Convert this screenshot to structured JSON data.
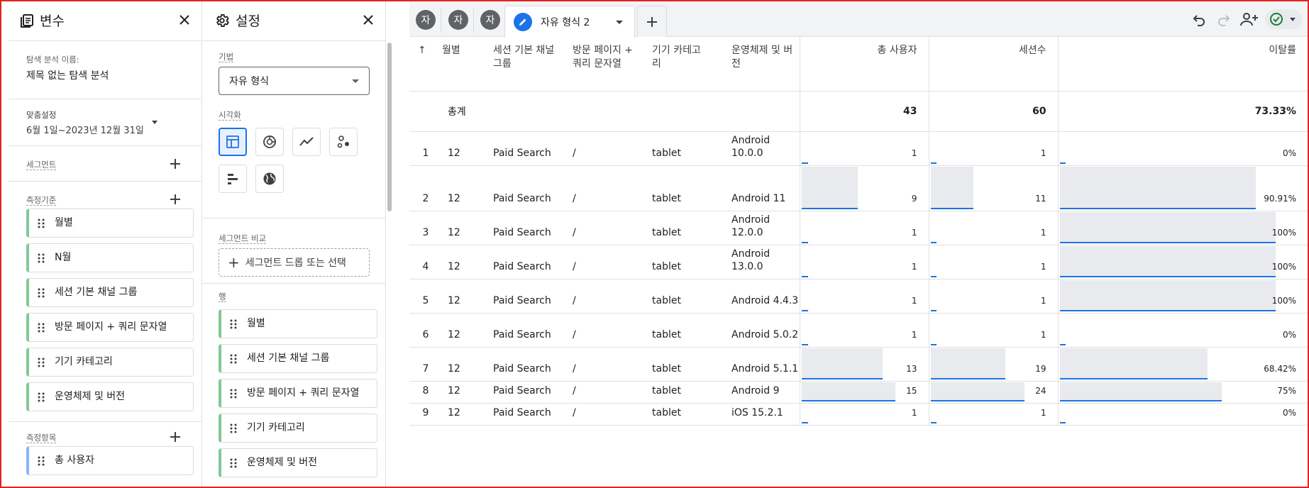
{
  "variables_panel": {
    "title": "변수",
    "exploration_name_label": "탐색 분석 이름:",
    "exploration_name": "제목 없는 탐색 분석",
    "date_label": "맞춤설정",
    "date_range": "6월 1일~2023년 12월 31일",
    "segments_label": "세그먼트",
    "dimensions_label": "측정기준",
    "dimensions": [
      "월별",
      "N월",
      "세션 기본 채널 그룹",
      "방문 페이지 + 쿼리 문자열",
      "기기 카테고리",
      "운영체제 및 버전"
    ],
    "metrics_label": "측정항목",
    "metrics": [
      "총 사용자"
    ]
  },
  "settings_panel": {
    "title": "설정",
    "technique_label": "기법",
    "technique": "자유 형식",
    "visualization_label": "시각화",
    "segment_compare_label": "세그먼트 비교",
    "segment_drop_text": "세그먼트 드롭 또는 선택",
    "rows_label": "행",
    "rows": [
      "월별",
      "세션 기본 채널 그룹",
      "방문 페이지 + 쿼리 문자열",
      "기기 카테고리",
      "운영체제 및 버전"
    ]
  },
  "tabs": {
    "mini_tabs": [
      "자",
      "자",
      "자"
    ],
    "active_tab": "자유 형식 2"
  },
  "table": {
    "headers": {
      "month": "월별",
      "channel": "세션 기본 채널 그룹",
      "landing": "방문 페이지 + 쿼리 문자열",
      "device": "기기 카테고리",
      "os": "운영체제 및 버전",
      "users": "총 사용자",
      "sessions": "세션수",
      "bounce": "이탈률"
    },
    "total_label": "총계",
    "totals": {
      "users": "43",
      "sessions": "60",
      "bounce": "73.33%"
    },
    "rows": [
      {
        "idx": "1",
        "month": "12",
        "channel": "Paid Search",
        "landing": "/",
        "device": "tablet",
        "os": "Android 10.0.0",
        "users": "1",
        "sessions": "1",
        "bounce": "0%",
        "users_frac": 0.067,
        "sessions_frac": 0.042,
        "bounce_frac": 0.0
      },
      {
        "idx": "2",
        "month": "12",
        "channel": "Paid Search",
        "landing": "/",
        "device": "tablet",
        "os": "Android 11",
        "users": "9",
        "sessions": "11",
        "bounce": "90.91%",
        "users_frac": 0.6,
        "sessions_frac": 0.458,
        "bounce_frac": 0.9091
      },
      {
        "idx": "3",
        "month": "12",
        "channel": "Paid Search",
        "landing": "/",
        "device": "tablet",
        "os": "Android 12.0.0",
        "users": "1",
        "sessions": "1",
        "bounce": "100%",
        "users_frac": 0.067,
        "sessions_frac": 0.042,
        "bounce_frac": 1.0
      },
      {
        "idx": "4",
        "month": "12",
        "channel": "Paid Search",
        "landing": "/",
        "device": "tablet",
        "os": "Android 13.0.0",
        "users": "1",
        "sessions": "1",
        "bounce": "100%",
        "users_frac": 0.067,
        "sessions_frac": 0.042,
        "bounce_frac": 1.0
      },
      {
        "idx": "5",
        "month": "12",
        "channel": "Paid Search",
        "landing": "/",
        "device": "tablet",
        "os": "Android 4.4.3",
        "users": "1",
        "sessions": "1",
        "bounce": "100%",
        "users_frac": 0.067,
        "sessions_frac": 0.042,
        "bounce_frac": 1.0
      },
      {
        "idx": "6",
        "month": "12",
        "channel": "Paid Search",
        "landing": "/",
        "device": "tablet",
        "os": "Android 5.0.2",
        "users": "1",
        "sessions": "1",
        "bounce": "0%",
        "users_frac": 0.067,
        "sessions_frac": 0.042,
        "bounce_frac": 0.0
      },
      {
        "idx": "7",
        "month": "12",
        "channel": "Paid Search",
        "landing": "/",
        "device": "tablet",
        "os": "Android 5.1.1",
        "users": "13",
        "sessions": "19",
        "bounce": "68.42%",
        "users_frac": 0.867,
        "sessions_frac": 0.792,
        "bounce_frac": 0.6842
      },
      {
        "idx": "8",
        "month": "12",
        "channel": "Paid Search",
        "landing": "/",
        "device": "tablet",
        "os": "Android 9",
        "users": "15",
        "sessions": "24",
        "bounce": "75%",
        "users_frac": 1.0,
        "sessions_frac": 1.0,
        "bounce_frac": 0.75
      },
      {
        "idx": "9",
        "month": "12",
        "channel": "Paid Search",
        "landing": "/",
        "device": "tablet",
        "os": "iOS 15.2.1",
        "users": "1",
        "sessions": "1",
        "bounce": "0%",
        "users_frac": 0.067,
        "sessions_frac": 0.042,
        "bounce_frac": 0.0
      }
    ]
  },
  "colors": {
    "accent": "#1a73e8",
    "dimension_chip": "#81c995",
    "metric_chip": "#8ab4f8",
    "bar_fill": "#e8eaed"
  },
  "icons": [
    "variables-icon",
    "close-icon",
    "gear-icon",
    "plus-icon",
    "grip-icon",
    "table-viz-icon",
    "donut-viz-icon",
    "line-viz-icon",
    "scatter-viz-icon",
    "bar-viz-icon",
    "geo-viz-icon",
    "pencil-icon",
    "undo-icon",
    "redo-icon",
    "share-icon",
    "status-check-icon",
    "sort-up-icon"
  ]
}
